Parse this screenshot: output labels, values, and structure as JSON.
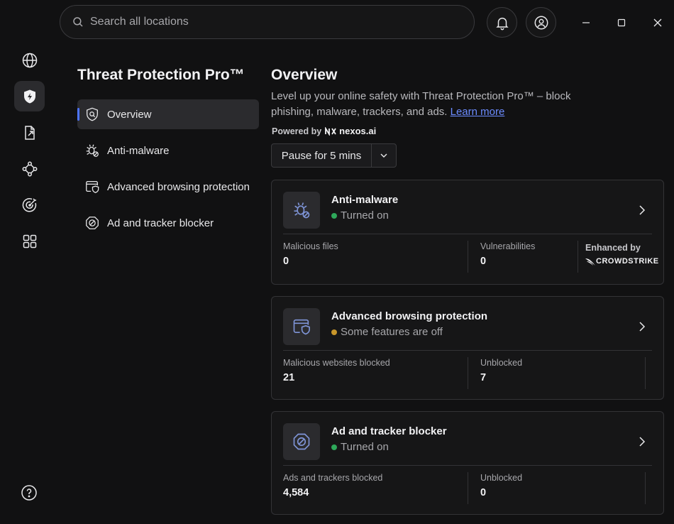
{
  "search": {
    "placeholder": "Search all locations"
  },
  "header": {
    "notifications_icon": "bell-icon",
    "account_icon": "user-icon",
    "window_controls": [
      "minimize-icon",
      "maximize-icon",
      "close-icon"
    ]
  },
  "rail": {
    "items": [
      {
        "icon": "globe-icon",
        "active": false
      },
      {
        "icon": "shield-bolt-icon",
        "active": true
      },
      {
        "icon": "file-share-icon",
        "active": false
      },
      {
        "icon": "mesh-network-icon",
        "active": false
      },
      {
        "icon": "target-icon",
        "active": false
      },
      {
        "icon": "apps-grid-icon",
        "active": false
      }
    ],
    "help_icon": "help-icon"
  },
  "section": {
    "title": "Threat Protection Pro™",
    "nav": [
      {
        "label": "Overview",
        "icon": "shield-search-icon",
        "active": true
      },
      {
        "label": "Anti-malware",
        "icon": "bug-icon",
        "active": false
      },
      {
        "label": "Advanced browsing protection",
        "icon": "browser-shield-icon",
        "active": false
      },
      {
        "label": "Ad and tracker blocker",
        "icon": "blocker-icon",
        "active": false
      }
    ]
  },
  "main": {
    "title": "Overview",
    "description": "Level up your online safety with Threat Protection Pro™ – block phishing, malware, trackers, and ads.",
    "learn_more": "Learn more",
    "powered_by": "Powered by",
    "powered_brand": "nexos.ai",
    "pause_label": "Pause for 5 mins"
  },
  "cards": {
    "antimalware": {
      "name": "Anti-malware",
      "status": "Turned on",
      "status_color": "#2ea85a",
      "stats": [
        {
          "label": "Malicious files",
          "value": "0"
        },
        {
          "label": "Vulnerabilities",
          "value": "0"
        }
      ],
      "enhanced_label": "Enhanced by",
      "enhanced_brand": "CROWDSTRIKE"
    },
    "browsing": {
      "name": "Advanced browsing protection",
      "status": "Some features are off",
      "status_color": "#c8962a",
      "stats": [
        {
          "label": "Malicious websites blocked",
          "value": "21"
        },
        {
          "label": "Unblocked",
          "value": "7"
        }
      ]
    },
    "adblock": {
      "name": "Ad and tracker blocker",
      "status": "Turned on",
      "status_color": "#2ea85a",
      "stats": [
        {
          "label": "Ads and trackers blocked",
          "value": "4,584"
        },
        {
          "label": "Unblocked",
          "value": "0"
        }
      ]
    }
  },
  "colors": {
    "accent": "#4d74ff",
    "link": "#6c8cff",
    "background": "#111112",
    "icon_blue": "#7f95d8"
  }
}
